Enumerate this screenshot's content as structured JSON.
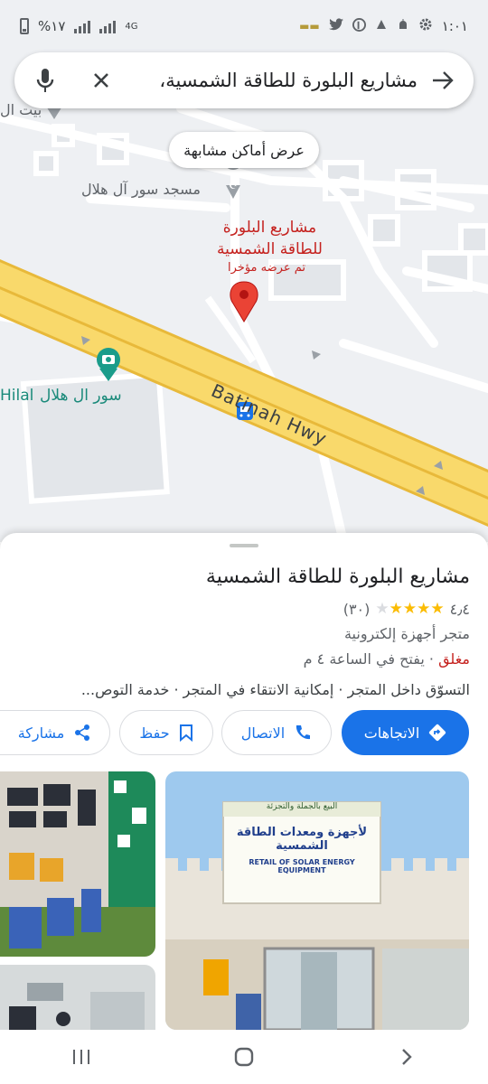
{
  "statusbar": {
    "time": "١:٠١",
    "battery": "%١٧",
    "network": "4G"
  },
  "search": {
    "query": "مشاريع البلورة للطاقة الشمسية،",
    "mic_icon": "mic-icon",
    "clear_icon": "close-icon",
    "back_icon": "arrow-back-icon"
  },
  "map": {
    "similar_places": "عرض أماكن مشابهة",
    "mosque_label": "مسجد سور آل هلال",
    "place_name_line1": "مشاريع البلورة",
    "place_name_line2": "للطاقة الشمسية",
    "recently_viewed": "تم عرضه مؤخرا",
    "sur_label": "سور ال هلال",
    "hilal_label": "Hilal",
    "beit_label": "بيت ال",
    "road_label": "Batinah Hwy",
    "colors": {
      "road_fill": "#f9d96b",
      "road_stroke": "#e8b93a",
      "pin": "#ea4335",
      "teal_poi": "#1a9c8a"
    }
  },
  "place": {
    "title": "مشاريع البلورة للطاقة الشمسية",
    "rating": "٤٫٤",
    "rating_value": 4.4,
    "reviews": "(٣٠)",
    "category": "متجر أجهزة إلكترونية",
    "status_closed": "مغلق",
    "opens": "· يفتح في الساعة ٤ م",
    "services": "التسوّق داخل المتجر · إمكانية الانتقاء في المتجر · خدمة التوص..."
  },
  "actions": {
    "directions": "الاتجاهات",
    "call": "الاتصال",
    "save": "حفظ",
    "share": "مشاركة",
    "accent": "#1a73e8"
  },
  "photos": {
    "sign_arabic_top": "البيع بالجملة والتجزئة",
    "sign_arabic_main": "لأجهزة ومعدات الطاقة الشمسية",
    "sign_english": "RETAIL OF SOLAR ENERGY EQUIPMENT"
  }
}
